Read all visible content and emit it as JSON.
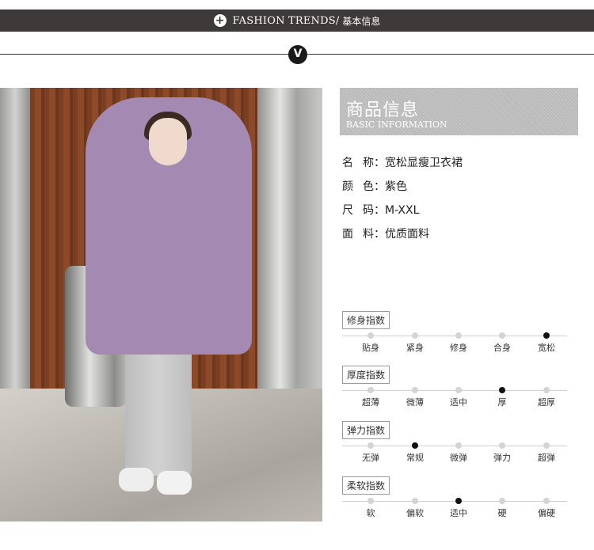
{
  "header": {
    "brand": "FASHION TRENDS/",
    "title": "基本信息",
    "chevron": "V"
  },
  "info": {
    "title_zh": "商品信息",
    "title_en": "BASIC INFORMATION",
    "specs": [
      {
        "key": "名 称",
        "value": "宽松显瘦卫衣裙"
      },
      {
        "key": "颜 色",
        "value": "紫色"
      },
      {
        "key": "尺 码",
        "value": "M-XXL"
      },
      {
        "key": "面 料",
        "value": "优质面料"
      }
    ]
  },
  "scales": [
    {
      "label": "修身指数",
      "options": [
        "贴身",
        "紧身",
        "修身",
        "合身",
        "宽松"
      ],
      "selected": 4
    },
    {
      "label": "厚度指数",
      "options": [
        "超薄",
        "微薄",
        "适中",
        "厚",
        "超厚"
      ],
      "selected": 3
    },
    {
      "label": "弹力指数",
      "options": [
        "无弹",
        "常规",
        "微弹",
        "弹力",
        "超弹"
      ],
      "selected": 1
    },
    {
      "label": "柔软指数",
      "options": [
        "软",
        "偏软",
        "适中",
        "硬",
        "偏硬"
      ],
      "selected": 2
    }
  ],
  "colors": {
    "bar": "#3e3a39",
    "hoodie": "#a48ab2"
  }
}
